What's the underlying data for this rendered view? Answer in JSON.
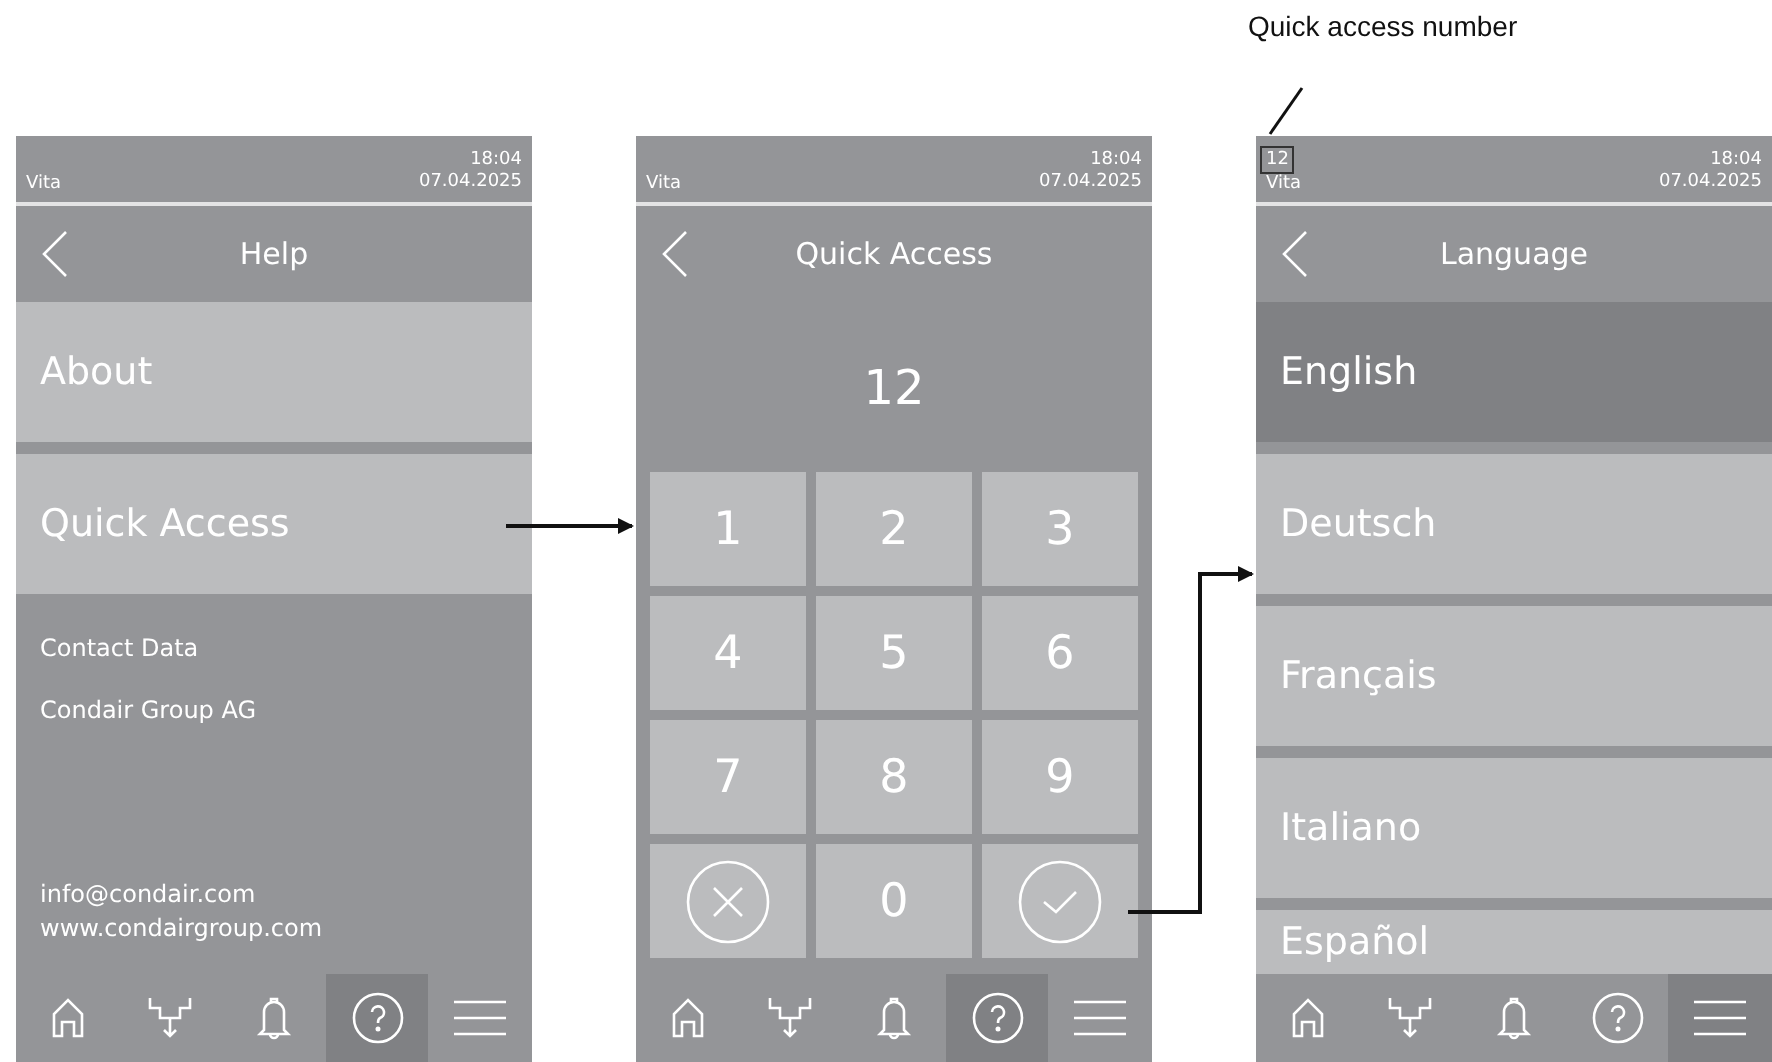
{
  "annotation": {
    "label": "Quick access number"
  },
  "screens": [
    {
      "kind": "menu",
      "status": {
        "device": "Vita",
        "time": "18:04",
        "date": "07.04.2025"
      },
      "title": "Help",
      "items": [
        {
          "label": "About"
        },
        {
          "label": "Quick Access"
        }
      ],
      "info": [
        "Contact Data",
        "Condair Group AG"
      ],
      "contact": [
        "info@condair.com",
        "www.condairgroup.com"
      ],
      "nav": [
        {
          "kind": "home",
          "selected": false
        },
        {
          "kind": "drain",
          "selected": false
        },
        {
          "kind": "alarm",
          "selected": false
        },
        {
          "kind": "help",
          "selected": true
        },
        {
          "kind": "menu",
          "selected": false
        }
      ]
    },
    {
      "kind": "keypad",
      "status": {
        "device": "Vita",
        "time": "18:04",
        "date": "07.04.2025"
      },
      "title": "Quick Access",
      "entry": "12",
      "keys": [
        {
          "kind": "digit",
          "label": "1"
        },
        {
          "kind": "digit",
          "label": "2"
        },
        {
          "kind": "digit",
          "label": "3"
        },
        {
          "kind": "digit",
          "label": "4"
        },
        {
          "kind": "digit",
          "label": "5"
        },
        {
          "kind": "digit",
          "label": "6"
        },
        {
          "kind": "digit",
          "label": "7"
        },
        {
          "kind": "digit",
          "label": "8"
        },
        {
          "kind": "digit",
          "label": "9"
        },
        {
          "kind": "cancel"
        },
        {
          "kind": "digit",
          "label": "0"
        },
        {
          "kind": "confirm"
        }
      ],
      "nav": [
        {
          "kind": "home",
          "selected": false
        },
        {
          "kind": "drain",
          "selected": false
        },
        {
          "kind": "alarm",
          "selected": false
        },
        {
          "kind": "help",
          "selected": true
        },
        {
          "kind": "menu",
          "selected": false
        }
      ]
    },
    {
      "kind": "list",
      "status": {
        "quick_number": "12",
        "device": "Vita",
        "time": "18:04",
        "date": "07.04.2025"
      },
      "title": "Language",
      "items": [
        {
          "label": "English",
          "selected": true
        },
        {
          "label": "Deutsch",
          "selected": false
        },
        {
          "label": "Français",
          "selected": false
        },
        {
          "label": "Italiano",
          "selected": false
        },
        {
          "label": "Español",
          "selected": false
        }
      ],
      "nav": [
        {
          "kind": "home",
          "selected": false
        },
        {
          "kind": "drain",
          "selected": false
        },
        {
          "kind": "alarm",
          "selected": false
        },
        {
          "kind": "help",
          "selected": false
        },
        {
          "kind": "menu",
          "selected": true
        }
      ]
    }
  ]
}
